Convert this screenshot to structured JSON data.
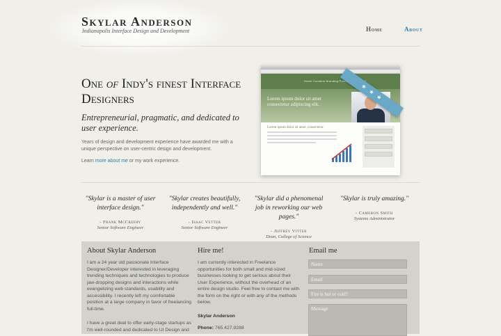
{
  "site": {
    "name": "Skylar Anderson",
    "tagline": "Indianapolis Interface Design and Development"
  },
  "nav": {
    "home": "Home",
    "about": "About"
  },
  "hero": {
    "title_a": "One ",
    "title_of": "of",
    "title_b": " Indy's finest Interface Designers",
    "subtitle": "Entrepreneurial, pragmatic, and dedicated to user experience.",
    "paragraph": "Years of design and development experience have awarded me with a unique perspective on user-centric design and development.",
    "learn_prefix": "Learn ",
    "learn_link": "more about me",
    "learn_suffix": " or my work experience."
  },
  "mockup": {
    "hero_text": "Lorem ipsum dolor sit amet consectetur adipiscing elit.",
    "nav_items": "Home    Combine    Branding    Press Pass    Contact",
    "body_heading": "Lorem ipsum dolor sit amet, consectetur",
    "ribbon": "★ ★ ★"
  },
  "testimonials": [
    {
      "quote": "\"Skylar is a master of user interface design.\"",
      "author": "- Frank McCreery",
      "role": "Senior Software Engineer"
    },
    {
      "quote": "\"Skylar creates beautifully, independently and well.\"",
      "author": "- Isaac Vetter",
      "role": "Senior Software Engineer"
    },
    {
      "quote": "\"Skylar did a phenomenal job in reworking our web pages.\"",
      "author": "- Jeffrey Vitter",
      "role": "Dean, College of Science"
    },
    {
      "quote": "\"Skylar is truly amazing.\"",
      "author": "- Cameron Smith",
      "role": "Systems Administrator"
    }
  ],
  "about": {
    "heading": "About Skylar Anderson",
    "p1": "I am a 24 year old passionate Interface Designer/Developer interested in leveraging trending techniques and technologies to produce jaw-dropping designs and interactions while evangelizing web standards, usability and accessibility. I recently left my comfortable position at a large company in favor of freelancing full-time.",
    "p2": "I have a great deal to offer early-stage startups as I'm well-rounded and dedicated to UI Design and"
  },
  "hire": {
    "heading": "Hire me!",
    "p1": "I am currently interested in Freelance opportunities for both small and mid-sized businesses looking to get serious about their User Experience, without the overhead of an entire design studio. Feel free to contact me with the form on the right or with any of the methods below.",
    "name": "Skylar Anderson",
    "phone_label": "Phone:",
    "phone": " 765.427.9288"
  },
  "email": {
    "heading": "Email me",
    "name_placeholder": "Name",
    "email_placeholder": "Email",
    "question_placeholder": "Fire is hot or cold?",
    "message_placeholder": "Message"
  },
  "colors": {
    "accent": "#2e7ea3",
    "background": "#f0efea",
    "panel": "#d3d2cb"
  }
}
